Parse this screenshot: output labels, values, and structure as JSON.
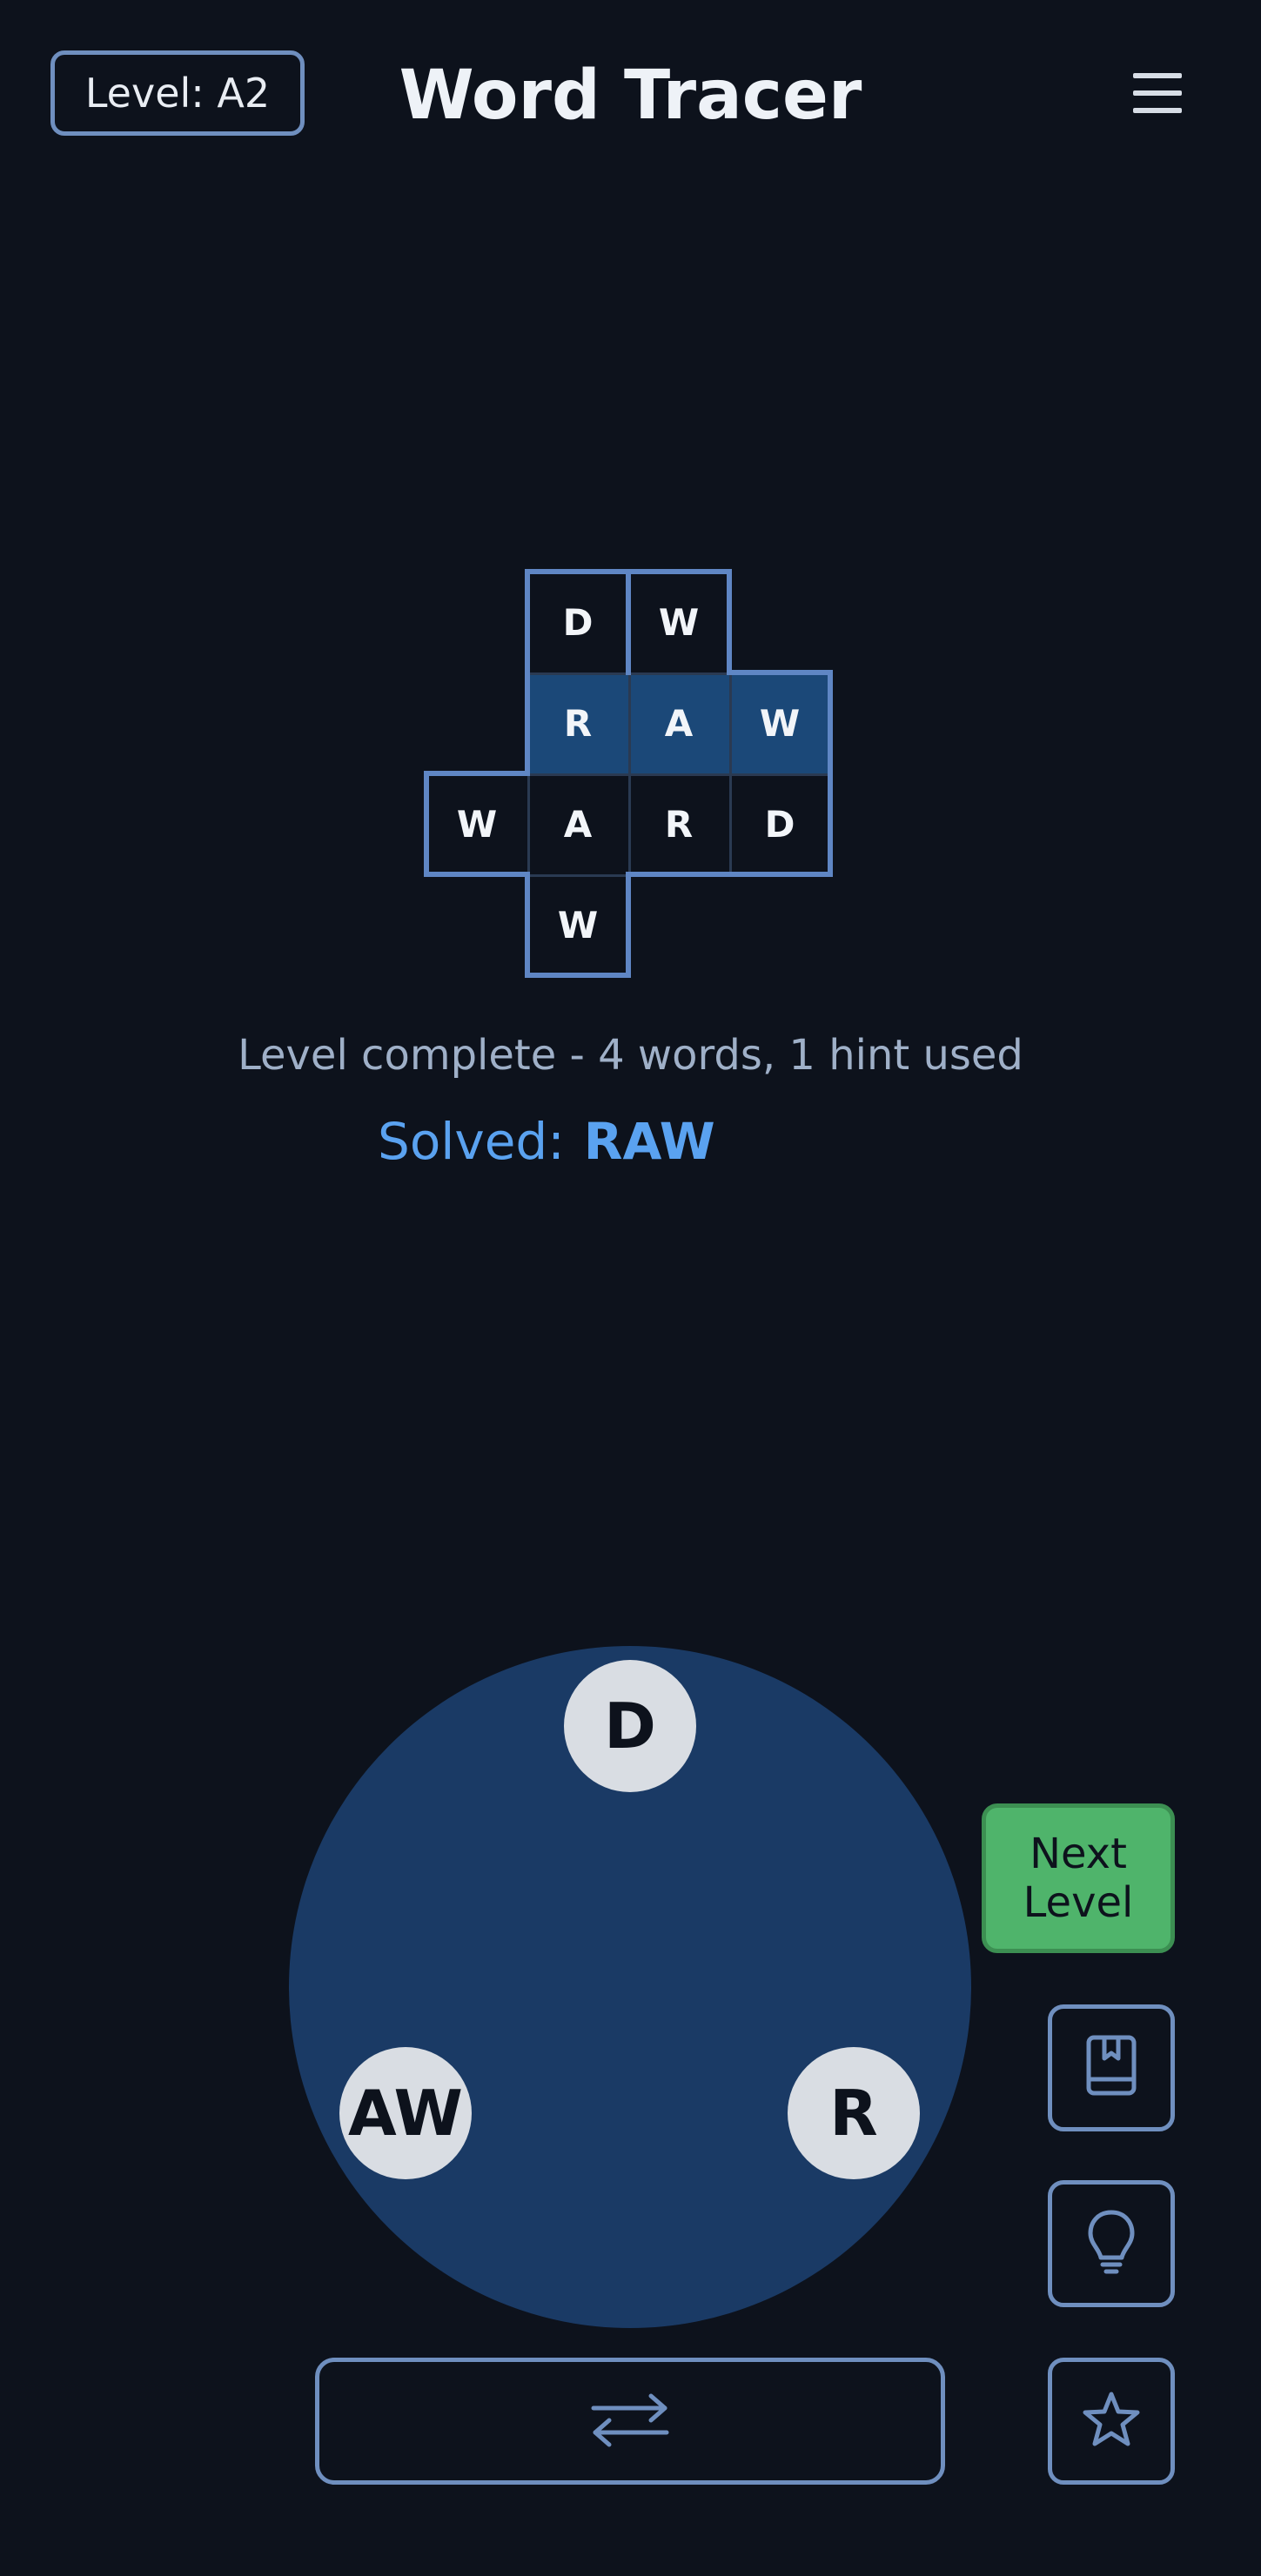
{
  "header": {
    "level_label": "Level: A2",
    "title": "Word Tracer",
    "menu_icon": "hamburger-menu-icon"
  },
  "grid": {
    "cells": [
      {
        "letter": "D",
        "row": 0,
        "col": 1,
        "state": "empty"
      },
      {
        "letter": "W",
        "row": 0,
        "col": 2,
        "state": "empty"
      },
      {
        "letter": "R",
        "row": 1,
        "col": 1,
        "state": "solved"
      },
      {
        "letter": "A",
        "row": 1,
        "col": 2,
        "state": "solved"
      },
      {
        "letter": "W",
        "row": 1,
        "col": 3,
        "state": "solved"
      },
      {
        "letter": "W",
        "row": 2,
        "col": 0,
        "state": "empty"
      },
      {
        "letter": "A",
        "row": 2,
        "col": 1,
        "state": "empty"
      },
      {
        "letter": "R",
        "row": 2,
        "col": 2,
        "state": "empty"
      },
      {
        "letter": "D",
        "row": 2,
        "col": 3,
        "state": "empty"
      },
      {
        "letter": "W",
        "row": 3,
        "col": 1,
        "state": "empty"
      }
    ]
  },
  "status": {
    "message": "Level complete - 4 words, 1 hint used",
    "solved_label": "Solved:",
    "solved_word": "RAW"
  },
  "wheel": {
    "tiles": [
      "D",
      "AW",
      "R"
    ]
  },
  "buttons": {
    "next_level": "Next Level",
    "dictionary_icon": "book-icon",
    "hint_icon": "lightbulb-icon",
    "favorite_icon": "star-icon",
    "shuffle_icon": "shuffle-arrows-icon"
  },
  "colors": {
    "background": "#0d121c",
    "accent": "#5aa2f0",
    "solved_cell": "#1b4878",
    "wheel": "#1a3a65",
    "next_button": "#4fb46b"
  }
}
